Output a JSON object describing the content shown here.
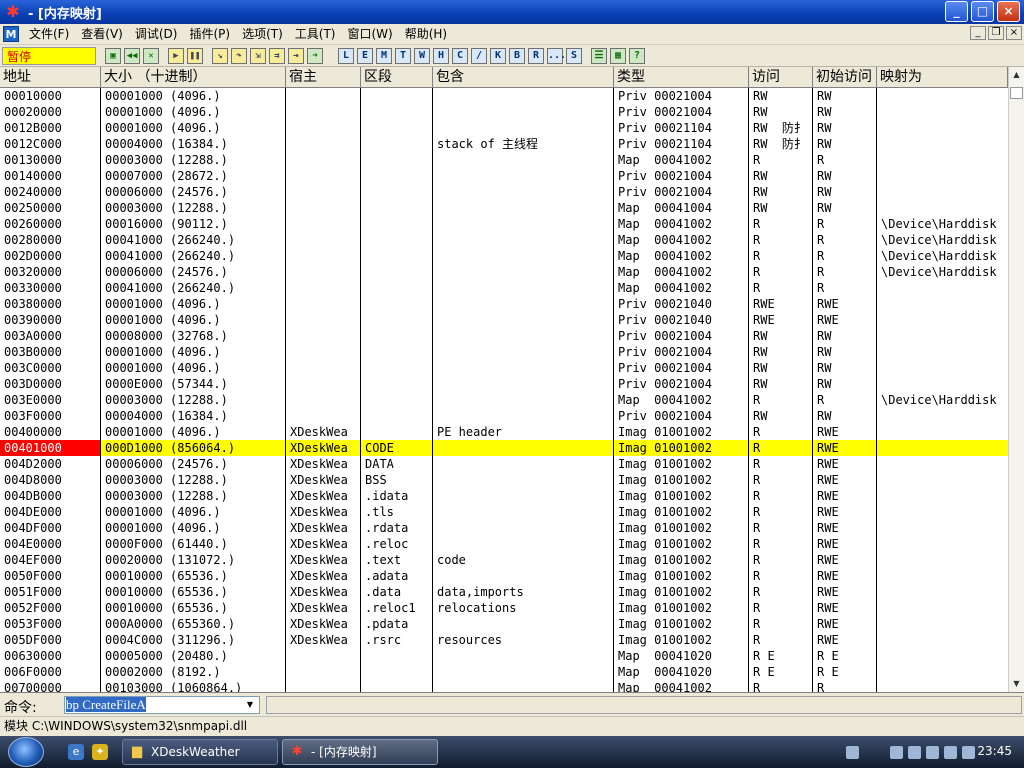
{
  "window": {
    "title": "- [内存映射]",
    "minimize": "_",
    "maximize": "□",
    "close": "×"
  },
  "menu": [
    "文件(F)",
    "查看(V)",
    "调试(D)",
    "插件(P)",
    "选项(T)",
    "工具(T)",
    "窗口(W)",
    "帮助(H)"
  ],
  "toolbar": {
    "status": "暂停",
    "icon_buttons": [
      "open",
      "rewind",
      "close",
      "run",
      "pause",
      "step-into",
      "step-over",
      "trace-into",
      "trace-over",
      "execute-till-return",
      "goto"
    ],
    "letter_buttons": [
      "L",
      "E",
      "M",
      "T",
      "W",
      "H",
      "C",
      "/",
      "K",
      "B",
      "R",
      "...",
      "S"
    ],
    "tail_buttons": [
      "list",
      "grid",
      "?"
    ]
  },
  "columns": [
    "地址",
    "大小 （十进制）",
    "宿主",
    "区段",
    "包含",
    "类型",
    "访问",
    "初始访问",
    "映射为"
  ],
  "rows": [
    [
      "00010000",
      "00001000 (4096.)",
      "",
      "",
      "",
      "Priv 00021004",
      "RW",
      "RW",
      ""
    ],
    [
      "00020000",
      "00001000 (4096.)",
      "",
      "",
      "",
      "Priv 00021004",
      "RW",
      "RW",
      ""
    ],
    [
      "0012B000",
      "00001000 (4096.)",
      "",
      "",
      "",
      "Priv 00021104",
      "RW  防扌",
      "RW",
      ""
    ],
    [
      "0012C000",
      "00004000 (16384.)",
      "",
      "",
      "stack of 主线程",
      "Priv 00021104",
      "RW  防扌",
      "RW",
      ""
    ],
    [
      "00130000",
      "00003000 (12288.)",
      "",
      "",
      "",
      "Map  00041002",
      "R",
      "R",
      ""
    ],
    [
      "00140000",
      "00007000 (28672.)",
      "",
      "",
      "",
      "Priv 00021004",
      "RW",
      "RW",
      ""
    ],
    [
      "00240000",
      "00006000 (24576.)",
      "",
      "",
      "",
      "Priv 00021004",
      "RW",
      "RW",
      ""
    ],
    [
      "00250000",
      "00003000 (12288.)",
      "",
      "",
      "",
      "Map  00041004",
      "RW",
      "RW",
      ""
    ],
    [
      "00260000",
      "00016000 (90112.)",
      "",
      "",
      "",
      "Map  00041002",
      "R",
      "R",
      "\\Device\\Harddisk"
    ],
    [
      "00280000",
      "00041000 (266240.)",
      "",
      "",
      "",
      "Map  00041002",
      "R",
      "R",
      "\\Device\\Harddisk"
    ],
    [
      "002D0000",
      "00041000 (266240.)",
      "",
      "",
      "",
      "Map  00041002",
      "R",
      "R",
      "\\Device\\Harddisk"
    ],
    [
      "00320000",
      "00006000 (24576.)",
      "",
      "",
      "",
      "Map  00041002",
      "R",
      "R",
      "\\Device\\Harddisk"
    ],
    [
      "00330000",
      "00041000 (266240.)",
      "",
      "",
      "",
      "Map  00041002",
      "R",
      "R",
      ""
    ],
    [
      "00380000",
      "00001000 (4096.)",
      "",
      "",
      "",
      "Priv 00021040",
      "RWE",
      "RWE",
      ""
    ],
    [
      "00390000",
      "00001000 (4096.)",
      "",
      "",
      "",
      "Priv 00021040",
      "RWE",
      "RWE",
      ""
    ],
    [
      "003A0000",
      "00008000 (32768.)",
      "",
      "",
      "",
      "Priv 00021004",
      "RW",
      "RW",
      ""
    ],
    [
      "003B0000",
      "00001000 (4096.)",
      "",
      "",
      "",
      "Priv 00021004",
      "RW",
      "RW",
      ""
    ],
    [
      "003C0000",
      "00001000 (4096.)",
      "",
      "",
      "",
      "Priv 00021004",
      "RW",
      "RW",
      ""
    ],
    [
      "003D0000",
      "0000E000 (57344.)",
      "",
      "",
      "",
      "Priv 00021004",
      "RW",
      "RW",
      ""
    ],
    [
      "003E0000",
      "00003000 (12288.)",
      "",
      "",
      "",
      "Map  00041002",
      "R",
      "R",
      "\\Device\\Harddisk"
    ],
    [
      "003F0000",
      "00004000 (16384.)",
      "",
      "",
      "",
      "Priv 00021004",
      "RW",
      "RW",
      ""
    ],
    [
      "00400000",
      "00001000 (4096.)",
      "XDeskWea",
      "",
      "PE header",
      "Imag 01001002",
      "R",
      "RWE",
      ""
    ],
    [
      "00401000",
      "000D1000 (856064.)",
      "XDeskWea",
      "CODE",
      "",
      "Imag 01001002",
      "R",
      "RWE",
      ""
    ],
    [
      "004D2000",
      "00006000 (24576.)",
      "XDeskWea",
      "DATA",
      "",
      "Imag 01001002",
      "R",
      "RWE",
      ""
    ],
    [
      "004D8000",
      "00003000 (12288.)",
      "XDeskWea",
      "BSS",
      "",
      "Imag 01001002",
      "R",
      "RWE",
      ""
    ],
    [
      "004DB000",
      "00003000 (12288.)",
      "XDeskWea",
      ".idata",
      "",
      "Imag 01001002",
      "R",
      "RWE",
      ""
    ],
    [
      "004DE000",
      "00001000 (4096.)",
      "XDeskWea",
      ".tls",
      "",
      "Imag 01001002",
      "R",
      "RWE",
      ""
    ],
    [
      "004DF000",
      "00001000 (4096.)",
      "XDeskWea",
      ".rdata",
      "",
      "Imag 01001002",
      "R",
      "RWE",
      ""
    ],
    [
      "004E0000",
      "0000F000 (61440.)",
      "XDeskWea",
      ".reloc",
      "",
      "Imag 01001002",
      "R",
      "RWE",
      ""
    ],
    [
      "004EF000",
      "00020000 (131072.)",
      "XDeskWea",
      ".text",
      "code",
      "Imag 01001002",
      "R",
      "RWE",
      ""
    ],
    [
      "0050F000",
      "00010000 (65536.)",
      "XDeskWea",
      ".adata",
      "",
      "Imag 01001002",
      "R",
      "RWE",
      ""
    ],
    [
      "0051F000",
      "00010000 (65536.)",
      "XDeskWea",
      ".data",
      "data,imports",
      "Imag 01001002",
      "R",
      "RWE",
      ""
    ],
    [
      "0052F000",
      "00010000 (65536.)",
      "XDeskWea",
      ".reloc1",
      "relocations",
      "Imag 01001002",
      "R",
      "RWE",
      ""
    ],
    [
      "0053F000",
      "000A0000 (655360.)",
      "XDeskWea",
      ".pdata",
      "",
      "Imag 01001002",
      "R",
      "RWE",
      ""
    ],
    [
      "005DF000",
      "0004C000 (311296.)",
      "XDeskWea",
      ".rsrc",
      "resources",
      "Imag 01001002",
      "R",
      "RWE",
      ""
    ],
    [
      "00630000",
      "00005000 (20480.)",
      "",
      "",
      "",
      "Map  00041020",
      "R E",
      "R E",
      ""
    ],
    [
      "006F0000",
      "00002000 (8192.)",
      "",
      "",
      "",
      "Map  00041020",
      "R E",
      "R E",
      ""
    ],
    [
      "00700000",
      "00103000 (1060864.)",
      "",
      "",
      "",
      "Map  00041002",
      "R",
      "R",
      ""
    ]
  ],
  "selected_row": 22,
  "command": {
    "label": "命令:",
    "value": "bp CreateFileA"
  },
  "status": "模块 C:\\WINDOWS\\system32\\snmpapi.dll",
  "taskbar": {
    "tasks": [
      "XDeskWeather",
      "- [内存映射]"
    ],
    "clock": "23:45"
  },
  "colors": {
    "selection": "#ffff00",
    "address_highlight": "#ff0000",
    "title_bar": "#0b3fb5"
  }
}
